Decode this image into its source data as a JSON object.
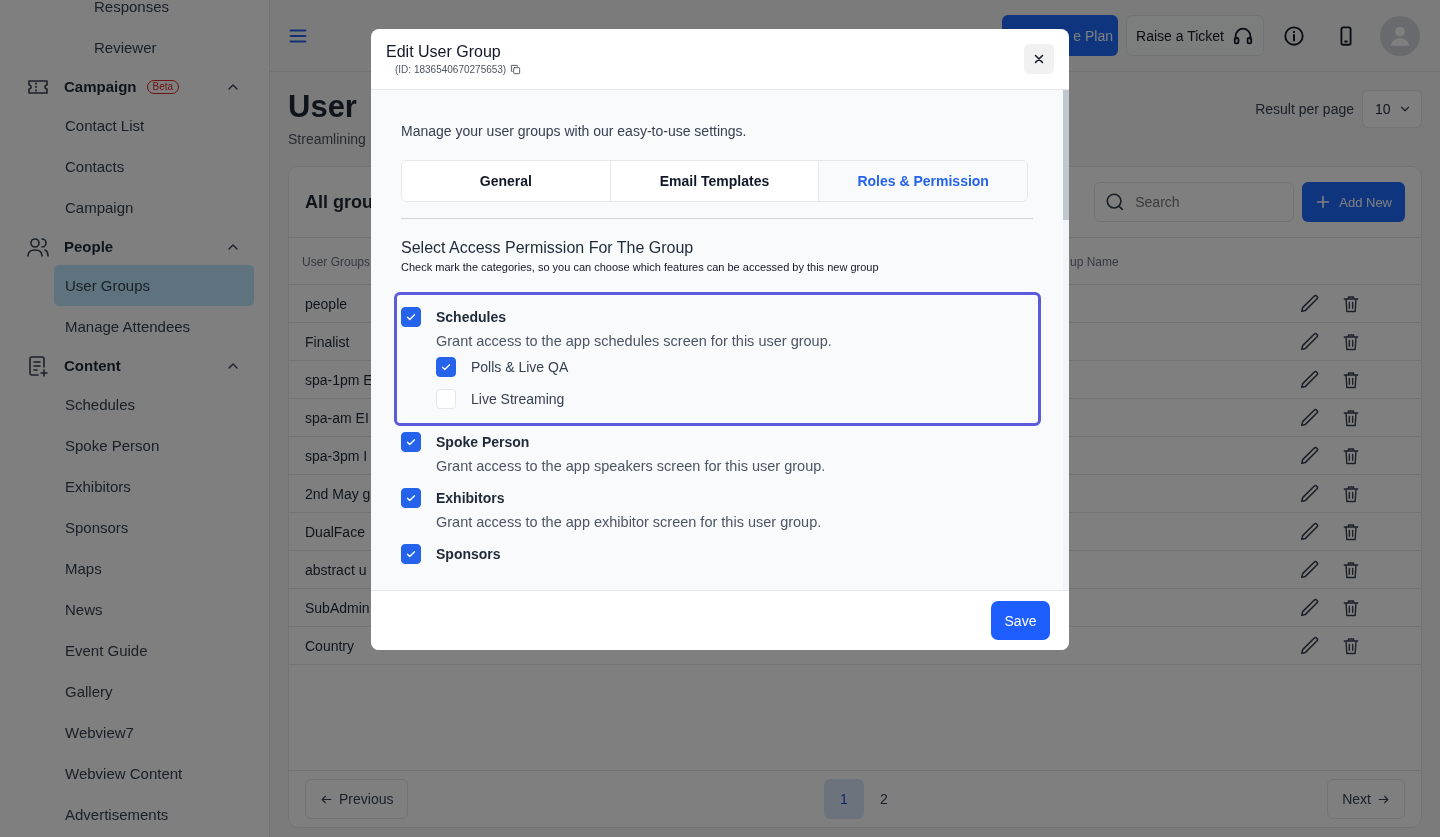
{
  "sidebar": {
    "items": [
      {
        "kind": "link",
        "label": "Responses"
      },
      {
        "kind": "link",
        "label": "Reviewer"
      },
      {
        "kind": "section",
        "label": "Campaign",
        "badge": "Beta",
        "expanded": true,
        "children": [
          {
            "label": "Contact List",
            "selected": false
          },
          {
            "label": "Contacts",
            "selected": false
          },
          {
            "label": "Campaign",
            "selected": false
          }
        ]
      },
      {
        "kind": "section",
        "label": "People",
        "expanded": true,
        "children": [
          {
            "label": "User Groups",
            "selected": true
          },
          {
            "label": "Manage Attendees",
            "selected": false
          }
        ]
      },
      {
        "kind": "section",
        "label": "Content",
        "expanded": true,
        "children": [
          {
            "label": "Schedules",
            "selected": false
          },
          {
            "label": "Spoke Person",
            "selected": false
          },
          {
            "label": "Exhibitors",
            "selected": false
          },
          {
            "label": "Sponsors",
            "selected": false
          },
          {
            "label": "Maps",
            "selected": false
          },
          {
            "label": "News",
            "selected": false
          },
          {
            "label": "Event Guide",
            "selected": false
          },
          {
            "label": "Gallery",
            "selected": false
          },
          {
            "label": "Webview7",
            "selected": false
          },
          {
            "label": "Webview Content",
            "selected": false
          },
          {
            "label": "Advertisements",
            "selected": false
          }
        ]
      }
    ]
  },
  "header": {
    "upgrade_button": "e Plan",
    "ticket_button": "Raise a Ticket"
  },
  "page": {
    "title": "User",
    "subtitle": "Streamlining",
    "result_label": "Result per page",
    "result_value": "10"
  },
  "card": {
    "title": "All grou",
    "search": {
      "placeholder": "Search"
    },
    "add_button": "Add New",
    "columns": [
      "User Groups",
      "up Name"
    ],
    "rows": [
      {
        "name": "people"
      },
      {
        "name": "Finalist"
      },
      {
        "name": "spa-1pm E"
      },
      {
        "name": "spa-am EI"
      },
      {
        "name": "spa-3pm I"
      },
      {
        "name": "2nd May g"
      },
      {
        "name": "DualFace"
      },
      {
        "name": "abstract u"
      },
      {
        "name": "SubAdmin"
      },
      {
        "name": "Country"
      }
    ],
    "pagination": {
      "previous": "Previous",
      "next": "Next",
      "pages": [
        {
          "label": "1",
          "selected": true
        },
        {
          "label": "2",
          "selected": false
        }
      ]
    }
  },
  "modal": {
    "title": "Edit User Group",
    "id": "(ID: 1836540670275653)",
    "intro": "Manage your user groups with our easy-to-use settings.",
    "tabs": [
      {
        "label": "General",
        "selected": false
      },
      {
        "label": "Email Templates",
        "selected": false
      },
      {
        "label": "Roles & Permission",
        "selected": true
      }
    ],
    "heading": "Select Access Permission For The Group",
    "subheading": "Check mark the categories, so you can choose which features can be accessed by this new group",
    "permissions": [
      {
        "label": "Schedules",
        "checked": true,
        "selected": true,
        "description": "Grant access to the app schedules screen for this user group.",
        "children": [
          {
            "label": "Polls & Live QA",
            "checked": true
          },
          {
            "label": "Live Streaming",
            "checked": false
          }
        ]
      },
      {
        "label": "Spoke Person",
        "checked": true,
        "selected": false,
        "description": "Grant access to the app speakers screen for this user group."
      },
      {
        "label": "Exhibitors",
        "checked": true,
        "selected": false,
        "description": "Grant access to the app exhibitor screen for this user group."
      },
      {
        "label": "Sponsors",
        "checked": true,
        "selected": false
      }
    ],
    "save_button": "Save"
  }
}
